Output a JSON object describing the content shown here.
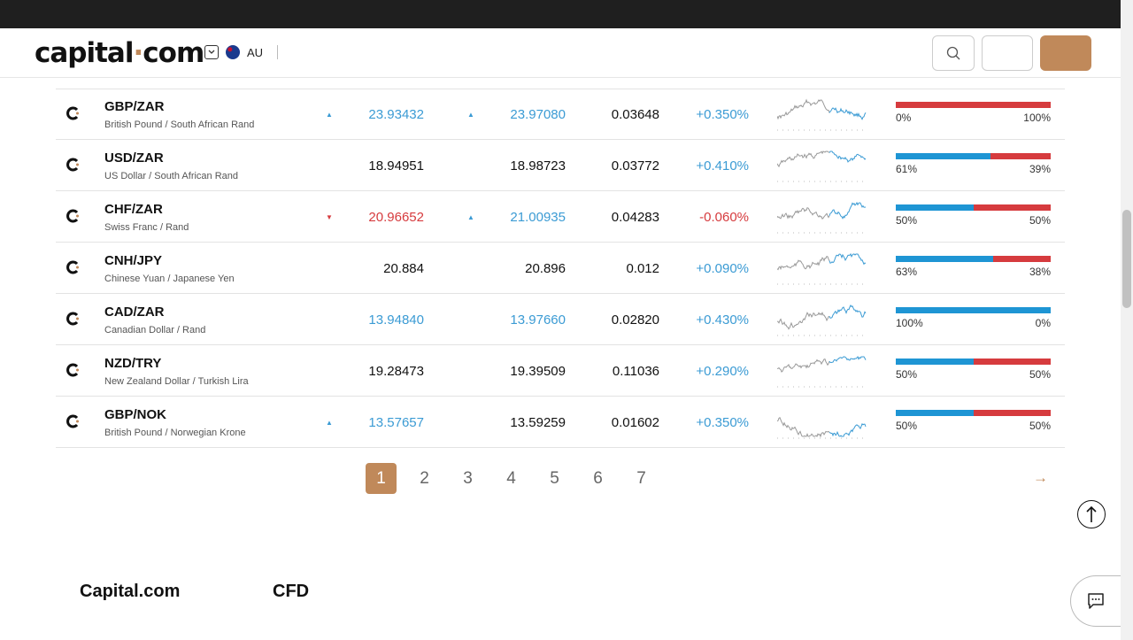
{
  "header": {
    "logo_main": "capital",
    "logo_dot": "·",
    "logo_suffix": "com",
    "region_code": "AU"
  },
  "rows": [
    {
      "pair": "GBP/ZAR",
      "desc": "British Pound / South African Rand",
      "arrow1": "▲",
      "arrow1_dir": "up",
      "sell": "23.93432",
      "sell_dir": "up",
      "arrow2": "▲",
      "arrow2_dir": "up",
      "buy": "23.97080",
      "buy_dir": "up",
      "spread": "0.03648",
      "change": "+0.350%",
      "change_dir": "up",
      "sent_buy_pct": 0,
      "sent_buy": "0%",
      "sent_sell": "100%"
    },
    {
      "pair": "USD/ZAR",
      "desc": "US Dollar / South African Rand",
      "arrow1": "",
      "arrow1_dir": "neutral",
      "sell": "18.94951",
      "sell_dir": "neutral",
      "arrow2": "",
      "arrow2_dir": "neutral",
      "buy": "18.98723",
      "buy_dir": "neutral",
      "spread": "0.03772",
      "change": "+0.410%",
      "change_dir": "up",
      "sent_buy_pct": 61,
      "sent_buy": "61%",
      "sent_sell": "39%"
    },
    {
      "pair": "CHF/ZAR",
      "desc": "Swiss Franc / Rand",
      "arrow1": "▼",
      "arrow1_dir": "down",
      "sell": "20.96652",
      "sell_dir": "down",
      "arrow2": "▲",
      "arrow2_dir": "up",
      "buy": "21.00935",
      "buy_dir": "up",
      "spread": "0.04283",
      "change": "-0.060%",
      "change_dir": "down",
      "sent_buy_pct": 50,
      "sent_buy": "50%",
      "sent_sell": "50%"
    },
    {
      "pair": "CNH/JPY",
      "desc": "Chinese Yuan / Japanese Yen",
      "arrow1": "",
      "arrow1_dir": "neutral",
      "sell": "20.884",
      "sell_dir": "neutral",
      "arrow2": "",
      "arrow2_dir": "neutral",
      "buy": "20.896",
      "buy_dir": "neutral",
      "spread": "0.012",
      "change": "+0.090%",
      "change_dir": "up",
      "sent_buy_pct": 63,
      "sent_buy": "63%",
      "sent_sell": "38%"
    },
    {
      "pair": "CAD/ZAR",
      "desc": "Canadian Dollar / Rand",
      "arrow1": "",
      "arrow1_dir": "neutral",
      "sell": "13.94840",
      "sell_dir": "up",
      "arrow2": "",
      "arrow2_dir": "neutral",
      "buy": "13.97660",
      "buy_dir": "up",
      "spread": "0.02820",
      "change": "+0.430%",
      "change_dir": "up",
      "sent_buy_pct": 100,
      "sent_buy": "100%",
      "sent_sell": "0%"
    },
    {
      "pair": "NZD/TRY",
      "desc": "New Zealand Dollar / Turkish Lira",
      "arrow1": "",
      "arrow1_dir": "neutral",
      "sell": "19.28473",
      "sell_dir": "neutral",
      "arrow2": "",
      "arrow2_dir": "neutral",
      "buy": "19.39509",
      "buy_dir": "neutral",
      "spread": "0.11036",
      "change": "+0.290%",
      "change_dir": "up",
      "sent_buy_pct": 50,
      "sent_buy": "50%",
      "sent_sell": "50%"
    },
    {
      "pair": "GBP/NOK",
      "desc": "British Pound / Norwegian Krone",
      "arrow1": "▲",
      "arrow1_dir": "up",
      "sell": "13.57657",
      "sell_dir": "up",
      "arrow2": "",
      "arrow2_dir": "neutral",
      "buy": "13.59259",
      "buy_dir": "neutral",
      "spread": "0.01602",
      "change": "+0.350%",
      "change_dir": "up",
      "sent_buy_pct": 50,
      "sent_buy": "50%",
      "sent_sell": "50%"
    }
  ],
  "pagination": {
    "pages": [
      "1",
      "2",
      "3",
      "4",
      "5",
      "6",
      "7"
    ],
    "active": "1",
    "next_icon": "→"
  },
  "footer": {
    "col1": "Capital.com",
    "col2": "CFD"
  },
  "colors": {
    "brand": "#c0895a",
    "up": "#3b9bd4",
    "down": "#d63b3e",
    "sentiment_buy": "#1e95d4",
    "sentiment_sell": "#d63b3e"
  },
  "icons": {
    "search": "search-icon",
    "chat": "chat-icon",
    "back_to_top": "arrow-up-icon"
  }
}
